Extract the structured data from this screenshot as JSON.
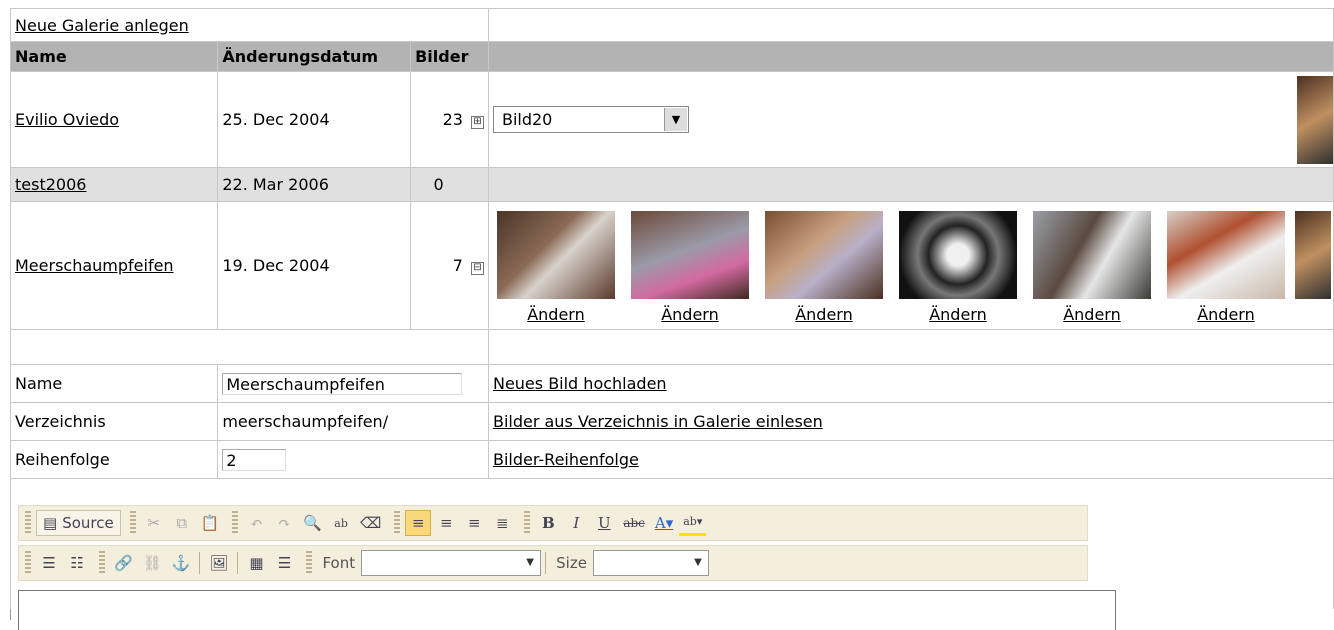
{
  "top_link": "Neue Galerie anlegen",
  "headers": {
    "name": "Name",
    "date": "Änderungsdatum",
    "pics": "Bilder"
  },
  "galleries": [
    {
      "name": "Evilio Oviedo",
      "date": "25. Dec 2004",
      "count": "23",
      "expander": "⊞",
      "select_value": "Bild20"
    },
    {
      "name": "test2006",
      "date": "22. Mar 2006",
      "count": "0"
    },
    {
      "name": "Meerschaumpfeifen",
      "date": "19. Dec 2004",
      "count": "7",
      "expander": "⊟",
      "thumb_link": "Ändern"
    }
  ],
  "thumb_labels": [
    "Ändern",
    "Ändern",
    "Ändern",
    "Ändern",
    "Ändern",
    "Ändern"
  ],
  "form": {
    "name_label": "Name",
    "name_value": "Meerschaumpfeifen",
    "dir_label": "Verzeichnis",
    "dir_value": "meerschaumpfeifen/",
    "order_label": "Reihenfolge",
    "order_value": "2",
    "upload_link": "Neues Bild hochladen",
    "import_link": "Bilder aus Verzeichnis in Galerie einlesen",
    "order_link": "Bilder-Reihenfolge"
  },
  "editor": {
    "source_label": "Source",
    "font_label": "Font",
    "size_label": "Size",
    "bold": "B",
    "italic": "I",
    "underline": "U",
    "strike": "abc",
    "textcolor": "A",
    "bgcolor": "ab"
  }
}
